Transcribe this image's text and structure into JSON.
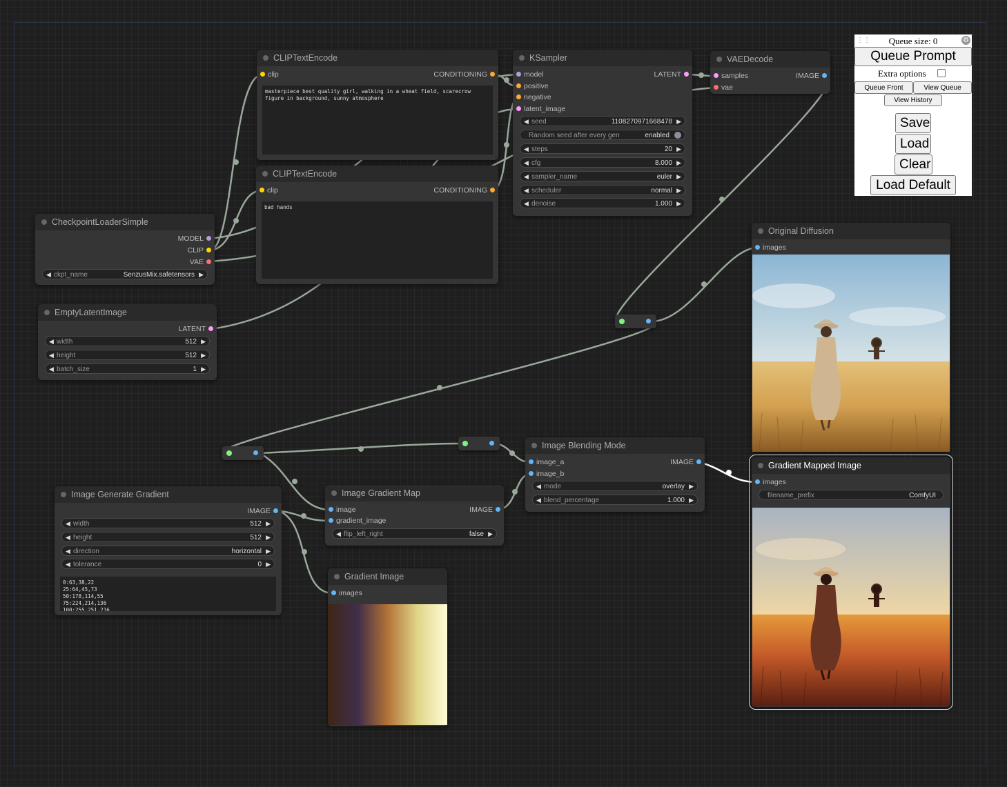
{
  "colors": {
    "model": "#b39ddb",
    "clip": "#ffd500",
    "vae": "#ff6e6e",
    "conditioning": "#ffa931",
    "latent": "#ff9cf9",
    "image": "#64b5f6",
    "link": "#9aa89a"
  },
  "nodes": {
    "clip_pos": {
      "title": "CLIPTextEncode",
      "in_clip": "clip",
      "out": "CONDITIONING",
      "text": "masterpiece best quality girl, walking in a wheat field, scarecrow figure in background, sunny atmosphere"
    },
    "clip_neg": {
      "title": "CLIPTextEncode",
      "in_clip": "clip",
      "out": "CONDITIONING",
      "text": "bad hands"
    },
    "ksampler": {
      "title": "KSampler",
      "in_model": "model",
      "in_positive": "positive",
      "in_negative": "negative",
      "in_latent": "latent_image",
      "out": "LATENT",
      "seed_label": "seed",
      "seed": "1108270971668478",
      "random_label": "Random seed after every gen",
      "random_value": "enabled",
      "steps_label": "steps",
      "steps": "20",
      "cfg_label": "cfg",
      "cfg": "8.000",
      "sampler_label": "sampler_name",
      "sampler": "euler",
      "scheduler_label": "scheduler",
      "scheduler": "normal",
      "denoise_label": "denoise",
      "denoise": "1.000"
    },
    "vaedecode": {
      "title": "VAEDecode",
      "in_samples": "samples",
      "in_vae": "vae",
      "out": "IMAGE"
    },
    "checkpoint": {
      "title": "CheckpointLoaderSimple",
      "out_model": "MODEL",
      "out_clip": "CLIP",
      "out_vae": "VAE",
      "ckpt_label": "ckpt_name",
      "ckpt": "SenzusMix.safetensors"
    },
    "latent": {
      "title": "EmptyLatentImage",
      "out": "LATENT",
      "width_label": "width",
      "width": "512",
      "height_label": "height",
      "height": "512",
      "batch_label": "batch_size",
      "batch": "1"
    },
    "orig": {
      "title": "Original Diffusion",
      "in_images": "images"
    },
    "blend": {
      "title": "Image Blending Mode",
      "in_a": "image_a",
      "in_b": "image_b",
      "out": "IMAGE",
      "mode_label": "mode",
      "mode": "overlay",
      "pct_label": "blend_percentage",
      "pct": "1.000"
    },
    "gmapped": {
      "title": "Gradient Mapped Image",
      "in_images": "images",
      "prefix_label": "filename_prefix",
      "prefix": "ComfyUI"
    },
    "gengrad": {
      "title": "Image Generate Gradient",
      "out": "IMAGE",
      "width_label": "width",
      "width": "512",
      "height_label": "height",
      "height": "512",
      "dir_label": "direction",
      "dir": "horizontal",
      "tol_label": "tolerance",
      "tol": "0",
      "stops": "0:63,38,22\n25:64,45,73\n50:178,114,55\n75:224,214,136\n100:255,251,216"
    },
    "gradmap": {
      "title": "Image Gradient Map",
      "in_image": "image",
      "in_grad": "gradient_image",
      "out": "IMAGE",
      "flip_label": "flip_left_right",
      "flip": "false"
    },
    "gradimg": {
      "title": "Gradient Image",
      "in_images": "images"
    }
  },
  "menu": {
    "queue_size": "Queue size: 0",
    "queue_prompt": "Queue Prompt",
    "extra_options": "Extra options",
    "queue_front": "Queue Front",
    "view_queue": "View Queue",
    "view_history": "View History",
    "save": "Save",
    "load": "Load",
    "clear": "Clear",
    "load_default": "Load Default"
  },
  "icons": {
    "drag": "drag-handle-icon",
    "gear": "gear-icon",
    "arrow_left": "◀",
    "arrow_right": "▶"
  }
}
